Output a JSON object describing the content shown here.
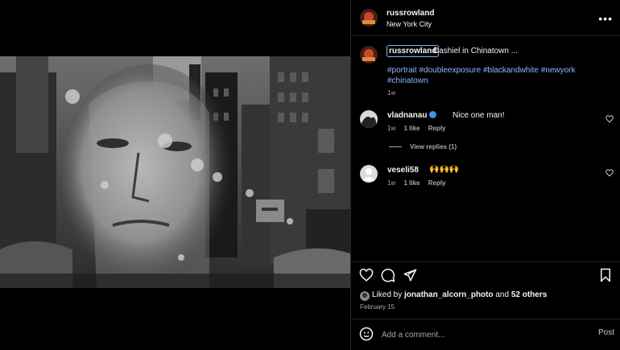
{
  "post": {
    "author": "russrowland",
    "location": "New York City",
    "more_icon": "more-horizontal-icon",
    "caption": {
      "username": "russrowland",
      "text": "Dashiel in Chinatown ...",
      "hashtags": [
        "#portrait",
        "#doubleexposure",
        "#blackandwhite",
        "#newyork",
        "#chinatown"
      ],
      "time": "1w"
    }
  },
  "comments": [
    {
      "username": "vladnanau",
      "verified": true,
      "text": "Nice one man!",
      "time": "1w",
      "likes": "1 like",
      "reply": "Reply",
      "view_replies": "View replies (1)"
    },
    {
      "username": "veseli58",
      "verified": false,
      "text": "🙌🙌🙌",
      "time": "1w",
      "likes": "1 like",
      "reply": "Reply"
    }
  ],
  "actions": {
    "like_icon": "heart-icon",
    "comment_icon": "comment-icon",
    "share_icon": "send-icon",
    "save_icon": "bookmark-icon"
  },
  "likes": {
    "prefix": "Liked by",
    "user": "jonathan_alcorn_photo",
    "joiner": "and",
    "others": "52 others"
  },
  "date": "February 15",
  "comment_input": {
    "placeholder": "Add a comment...",
    "post_label": "Post",
    "emoji_icon": "smiley-icon"
  },
  "colors": {
    "background": "#000000",
    "hashtag": "#8eb7ff",
    "secondary_text": "#a8a8a8",
    "verified": "#3897f0"
  }
}
